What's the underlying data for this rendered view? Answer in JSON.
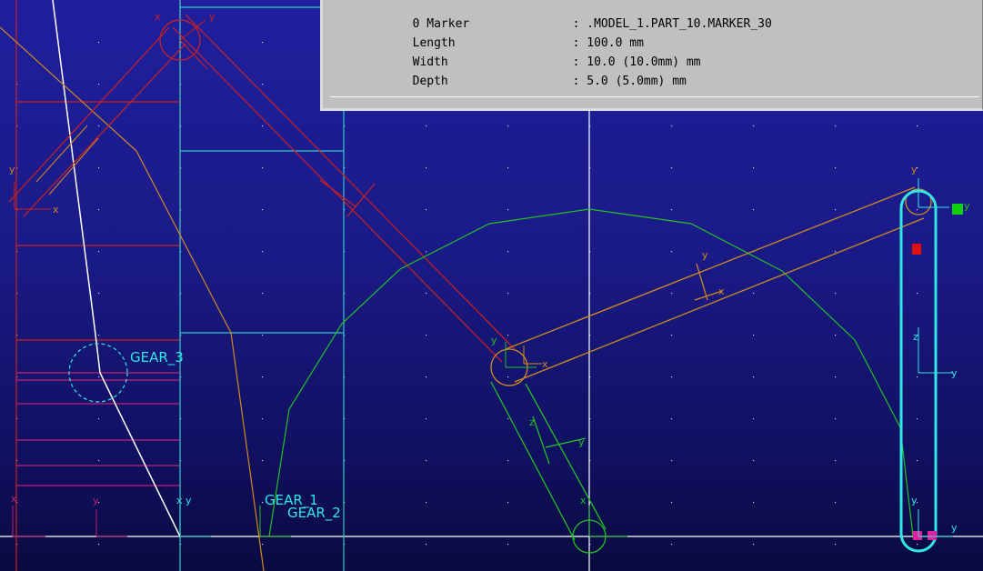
{
  "info_panel": {
    "rows": [
      {
        "key": "0 Marker",
        "value": ": .MODEL_1.PART_10.MARKER_30"
      },
      {
        "key": "Length",
        "value": ": 100.0 mm"
      },
      {
        "key": "Width",
        "value": ": 10.0 (10.0mm) mm"
      },
      {
        "key": "Depth",
        "value": ": 5.0 (5.0mm) mm"
      }
    ]
  },
  "labels": {
    "gear_3": "GEAR_3",
    "gear_1": "GEAR_1",
    "gear_2": "GEAR_2"
  },
  "axis_letters": {
    "x": "x",
    "y": "y",
    "z": "z"
  },
  "colors": {
    "background_top": "#1f1f9e",
    "background_bottom": "#0a0a40",
    "cyan": "#33e6e6",
    "orange": "#d08a20",
    "red": "#cc2020",
    "green": "#22c022",
    "magenta": "#c0207a",
    "white": "#ffffff",
    "panel_bg": "#c0c0c0"
  }
}
